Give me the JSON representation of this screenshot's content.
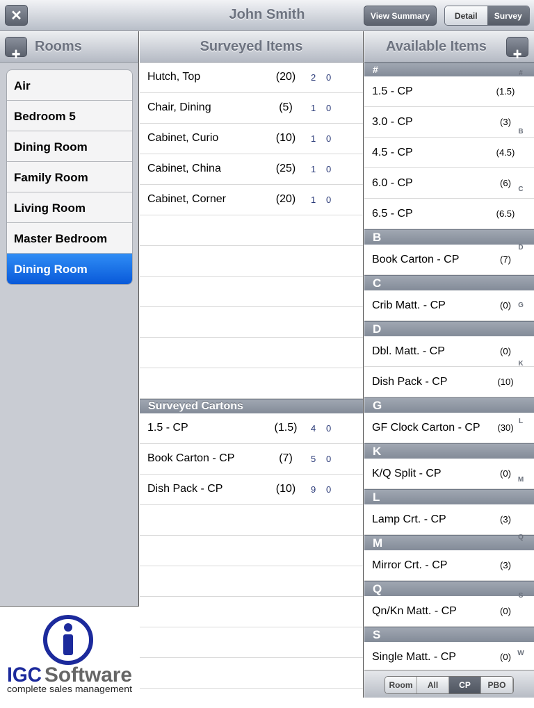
{
  "header": {
    "title": "John Smith",
    "close_icon": "close-icon",
    "view_summary": "View Summary",
    "segments": [
      {
        "label": "Detail",
        "selected": false
      },
      {
        "label": "Survey",
        "selected": true
      }
    ]
  },
  "rooms": {
    "title": "Rooms",
    "items": [
      "Air",
      "Bedroom 5",
      "Dining Room",
      "Family Room",
      "Living Room",
      "Master Bedroom",
      "Dining Room"
    ],
    "selected_index": 6,
    "selected_color": "#0a5ddb"
  },
  "logo": {
    "brand_a": "IGC",
    "brand_b": "Software",
    "tagline": "complete sales management",
    "color_blue": "#1c2a9c",
    "color_gray": "#666666"
  },
  "surveyed": {
    "title": "Surveyed Items",
    "items": [
      {
        "name": "Hutch, Top",
        "value": "(20)",
        "a": "2",
        "b": "0"
      },
      {
        "name": "Chair, Dining",
        "value": "(5)",
        "a": "1",
        "b": "0"
      },
      {
        "name": "Cabinet, Curio",
        "value": "(10)",
        "a": "1",
        "b": "0"
      },
      {
        "name": "Cabinet, China",
        "value": "(25)",
        "a": "1",
        "b": "0"
      },
      {
        "name": "Cabinet, Corner",
        "value": "(20)",
        "a": "1",
        "b": "0"
      }
    ],
    "cartons_title": "Surveyed Cartons",
    "cartons": [
      {
        "name": "1.5 - CP",
        "value": "(1.5)",
        "a": "4",
        "b": "0"
      },
      {
        "name": "Book Carton - CP",
        "value": "(7)",
        "a": "5",
        "b": "0"
      },
      {
        "name": "Dish Pack - CP",
        "value": "(10)",
        "a": "9",
        "b": "0"
      }
    ]
  },
  "available": {
    "title": "Available Items",
    "sections": [
      {
        "letter": "#",
        "items": [
          {
            "name": "1.5 - CP",
            "value": "(1.5)"
          },
          {
            "name": "3.0 - CP",
            "value": "(3)"
          },
          {
            "name": "4.5 - CP",
            "value": "(4.5)"
          },
          {
            "name": "6.0 - CP",
            "value": "(6)"
          },
          {
            "name": "6.5 - CP",
            "value": "(6.5)"
          }
        ]
      },
      {
        "letter": "B",
        "items": [
          {
            "name": "Book Carton - CP",
            "value": "(7)"
          }
        ]
      },
      {
        "letter": "C",
        "items": [
          {
            "name": "Crib Matt. - CP",
            "value": "(0)"
          }
        ]
      },
      {
        "letter": "D",
        "items": [
          {
            "name": "Dbl. Matt. - CP",
            "value": "(0)"
          },
          {
            "name": "Dish Pack - CP",
            "value": "(10)"
          }
        ]
      },
      {
        "letter": "G",
        "items": [
          {
            "name": "GF Clock Carton - CP",
            "value": "(30)"
          }
        ]
      },
      {
        "letter": "K",
        "items": [
          {
            "name": "K/Q Split  - CP",
            "value": "(0)"
          }
        ]
      },
      {
        "letter": "L",
        "items": [
          {
            "name": "Lamp Crt. - CP",
            "value": "(3)"
          }
        ]
      },
      {
        "letter": "M",
        "items": [
          {
            "name": "Mirror Crt. - CP",
            "value": "(3)"
          }
        ]
      },
      {
        "letter": "Q",
        "items": [
          {
            "name": "Qn/Kn Matt. - CP",
            "value": "(0)"
          }
        ]
      },
      {
        "letter": "S",
        "items": [
          {
            "name": "Single Matt. - CP",
            "value": "(0)"
          }
        ]
      }
    ],
    "index": [
      "#",
      "B",
      "C",
      "D",
      "G",
      "K",
      "L",
      "M",
      "Q",
      "S",
      "W"
    ],
    "filters": [
      {
        "label": "Room",
        "selected": false
      },
      {
        "label": "All",
        "selected": false
      },
      {
        "label": "CP",
        "selected": true
      },
      {
        "label": "PBO",
        "selected": false
      }
    ]
  }
}
